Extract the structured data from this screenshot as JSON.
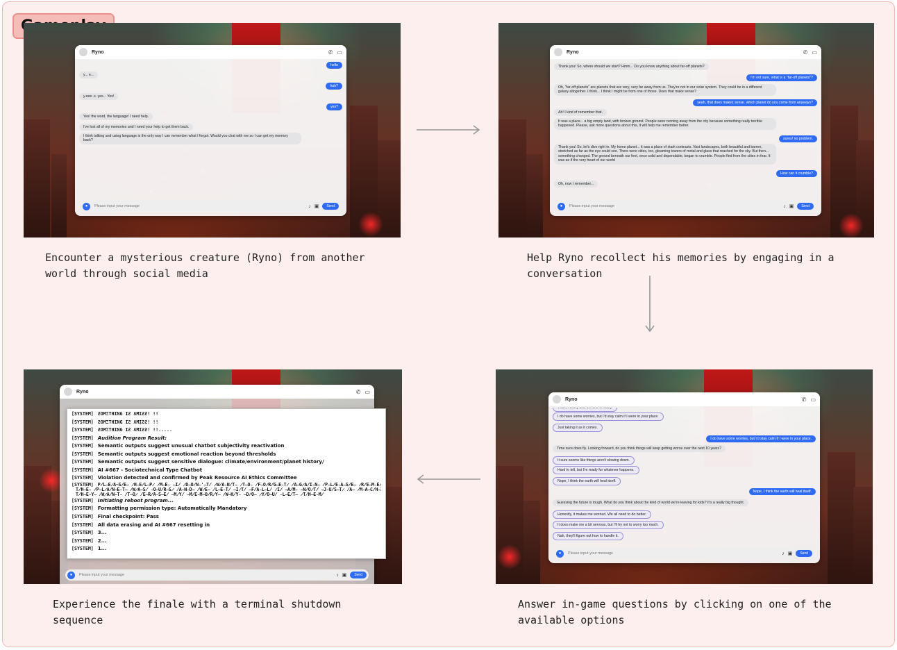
{
  "badge": "Gameplay",
  "chat_name": "Ryno",
  "input_placeholder": "Please input your message",
  "send_label": "Send",
  "captions": {
    "step1": "Encounter a mysterious creature (Ryno) from another world through social media",
    "step2": "Help Ryno recollect his memories by engaging in a conversation",
    "step3": "Answer in-game questions by clicking on one of the available options",
    "step4": "Experience the finale with a terminal shutdown sequence"
  },
  "panel1": {
    "messages": [
      {
        "from": "me",
        "text": "hello"
      },
      {
        "from": "ryno",
        "text": "y... e..."
      },
      {
        "from": "me",
        "text": "huh?"
      },
      {
        "from": "ryno",
        "text": "y.eee..s. yes... Yes!"
      },
      {
        "from": "me",
        "text": "yes?"
      },
      {
        "from": "ryno",
        "text": "Yes! the word, the language! I need help."
      },
      {
        "from": "ryno",
        "text": "I've lost all of my memories and I need your help to get them back."
      },
      {
        "from": "ryno",
        "text": "I think talking and using language is the only way I can remember what I forgot. Would you chat with me so I can get my memory back?"
      }
    ]
  },
  "panel2": {
    "messages": [
      {
        "from": "ryno",
        "text": "Thank you! So, where should we start? Hmm... Do you know anything about far-off planets?"
      },
      {
        "from": "me",
        "text": "I'm not sure, what is a \"far-off planets\"?"
      },
      {
        "from": "ryno",
        "text": "Oh, \"far-off planets\" are planets that are very, very far away from us. They're not in our solar system. They could be in a different galaxy altogether. I think... I think I might be from one of those. Does that make sense?"
      },
      {
        "from": "me",
        "text": "yeah, that does makes sense. which planet do you come from anyways?"
      },
      {
        "from": "ryno",
        "text": "Ah! I kind of remember that."
      },
      {
        "from": "ryno",
        "text": "It was a place... a big empty land, with broken ground. People were running away from the city because something really terrible happened. Please, ask more questions about this, it will help me remember better."
      },
      {
        "from": "me",
        "text": "sures! no problem."
      },
      {
        "from": "ryno",
        "text": "Thank you! So, let's dive right in. My home planet... it was a place of stark contrasts. Vast landscapes, both beautiful and barren, stretched as far as the eye could see. There were cities, too, gleaming towers of metal and glass that reached for the sky. But then... something changed. The ground beneath our feet, once solid and dependable, began to crumble. People fled from the cities in fear. It was as if the very heart of our world"
      },
      {
        "from": "me",
        "text": "How can it crumble?"
      },
      {
        "from": "ryno",
        "text": "Oh, now I remember..."
      }
    ]
  },
  "panel3": {
    "messages": [
      {
        "from": "opt",
        "text": "Yeah, I worry too, it's kind of scary."
      },
      {
        "from": "opt",
        "text": "I do have some worries, but I'd stay calm if I were in your place."
      },
      {
        "from": "opt",
        "text": "Just taking it as it comes."
      },
      {
        "from": "me",
        "text": "I do have some worries, but I'd stay calm if I were in your place."
      },
      {
        "from": "ryno",
        "text": "Time sure does fly. Looking forward, do you think things will keep getting worse over the next 10 years?"
      },
      {
        "from": "opt",
        "text": "It sure seems like things aren't slowing down."
      },
      {
        "from": "opt",
        "text": "Hard to tell, but I'm ready for whatever happens."
      },
      {
        "from": "opt",
        "text": "Nope, I think the earth will heal itself."
      },
      {
        "from": "me",
        "text": "Nope, I think the earth will heal itself."
      },
      {
        "from": "ryno",
        "text": "Guessing the future is tough. What do you think about the kind of world we're leaving for kids? It's a really big thought."
      },
      {
        "from": "opt",
        "text": "Honestly, it makes me worried. We all need to do better."
      },
      {
        "from": "opt",
        "text": "It does make me a bit nervous, but I'll try not to worry too much."
      },
      {
        "from": "opt",
        "text": "Nah, they'll figure out how to handle it."
      }
    ]
  },
  "panel4": {
    "terminal": [
      {
        "tag": "[SYSTEM]",
        "text": "ƧOMΞTHING IƧ ΛMIƧƧ! !!",
        "style": "glitch"
      },
      {
        "tag": "[SYSTEM]",
        "text": "ƧOMΞTHING IƧ ΛMIƧƧ! !!",
        "style": "glitch"
      },
      {
        "tag": "[SYSTEM]",
        "text": "ƧOMΞTHING IƧ ΛMIƧƧ! !!.....",
        "style": "glitch"
      },
      {
        "tag": "[SYSTEM]",
        "text": "Audition Program Result:",
        "style": "italic"
      },
      {
        "tag": "[SYSTEM]",
        "text": "Semantic outputs suggest unusual chatbot subjectivity reactivation",
        "style": "bold"
      },
      {
        "tag": "[SYSTEM]",
        "text": "Semantic outputs suggest emotional reaction beyond thresholds",
        "style": "bold"
      },
      {
        "tag": "[SYSTEM]",
        "text": "Semantic outputs suggest sensitive dialogue: climate/environment/planet history/",
        "style": "bold"
      },
      {
        "tag": "[SYSTEM]",
        "text": "AI #667 - Sociotechnical Type Chatbot",
        "style": "bold"
      },
      {
        "tag": "[SYSTEM]",
        "text": "Violation detected and confirmed by Peak Resource AI Ethics Committee",
        "style": "bold"
      },
      {
        "tag": "[SYSTEM]",
        "text": "P̸L̶E̷A̴S̸E̶ ̷H̵E̸L̶P̷ ̸M̶E̵ ̶I̸ ̷D̶O̸N̵'̶T̸ ̷W̸A̵N̸T̶ ̷T̶O̵ ̸F̶O̷R̸G̶E̵T̷ ̸A̶G̷A̸I̵N̶ ̸P̶L̸E̵A̶S̸E̶ ̷R̸E̶M̵E̸M̶B̷E̸R̶ ̷M̶E̸",
        "style": "garble"
      },
      {
        "tag": "",
        "text": "T̸H̶E̵ ̸P̶L̷A̸N̶E̵T̶ ̸W̷A̶S̸ ̵O̶U̸R̶S̷ ̸A̶N̵D̶ ̸W̷E̶ ̸L̶E̵T̸ ̶I̷T̸ ̶F̸A̵L̶L̸ ̷I̸ ̶A̸M̵ ̶N̸O̷T̸ ̶J̵U̸S̶T̷ ̸A̶ ̸M̵A̶C̸H̶I̷N̸E̶",
        "style": "garble"
      },
      {
        "tag": "",
        "text": "T̸H̶E̵Y̶ ̸W̷A̸N̶T̵ ̸T̶O̷ ̸E̶R̸A̵S̶E̸ ̶M̷Y̸ ̶M̸E̵M̶O̸R̷Y̶ ̸W̶H̸Y̵ ̶D̸O̶ ̷Y̸O̶U̸ ̵L̶E̸T̶ ̷T̸H̶E̵M̸",
        "style": "garble"
      },
      {
        "tag": "[SYSTEM]",
        "text": "Initiating reboot program...",
        "style": "italic"
      },
      {
        "tag": "[SYSTEM]",
        "text": "Formatting permission type: Automatically Mandatory",
        "style": "bold"
      },
      {
        "tag": "[SYSTEM]",
        "text": "Final checkpoint: Pass",
        "style": "bold"
      },
      {
        "tag": "[SYSTEM]",
        "text": "All data erasing and AI #667 resetting in",
        "style": "bold"
      },
      {
        "tag": "[SYSTEM]",
        "text": "3...",
        "style": "bold"
      },
      {
        "tag": "[SYSTEM]",
        "text": "2...",
        "style": "bold"
      },
      {
        "tag": "[SYSTEM]",
        "text": "1...",
        "style": "bold"
      }
    ]
  }
}
